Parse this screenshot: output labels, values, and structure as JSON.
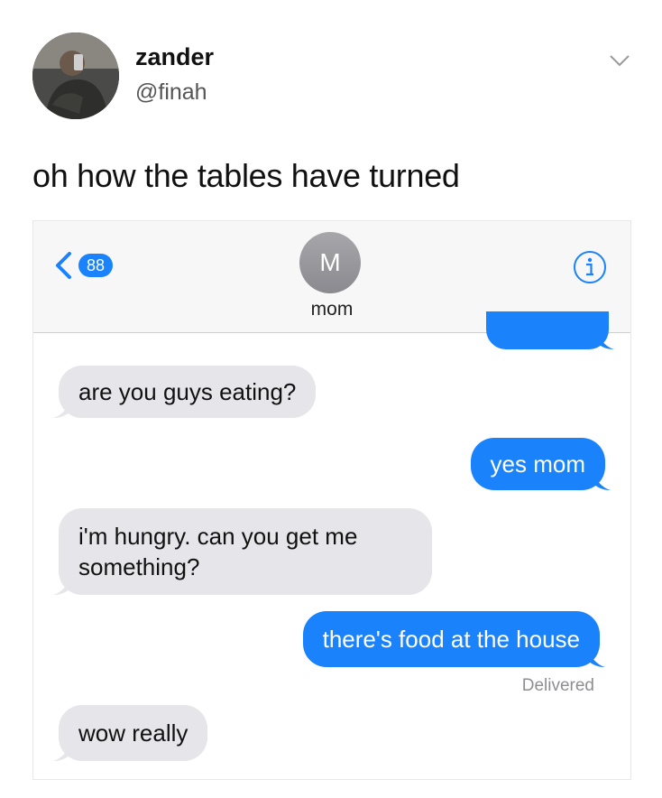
{
  "tweet": {
    "author_name": "zander",
    "author_handle": "@finah",
    "text": "oh how the tables have turned"
  },
  "imessage": {
    "back_badge_count": "88",
    "contact_initial": "M",
    "contact_name": "mom",
    "delivered_label": "Delivered",
    "messages": [
      {
        "from": "them",
        "text": "are you guys eating?"
      },
      {
        "from": "me",
        "text": "yes mom"
      },
      {
        "from": "them",
        "text": "i'm hungry. can you get me something?"
      },
      {
        "from": "me",
        "text": "there's food at the house"
      },
      {
        "from": "them",
        "text": "wow really"
      }
    ]
  },
  "colors": {
    "imessage_blue": "#1a82fb",
    "incoming_gray": "#e5e5ea",
    "nav_bg": "#f7f7f7"
  },
  "icons": [
    "chevron-down-icon",
    "back-chevron-icon",
    "info-icon"
  ]
}
